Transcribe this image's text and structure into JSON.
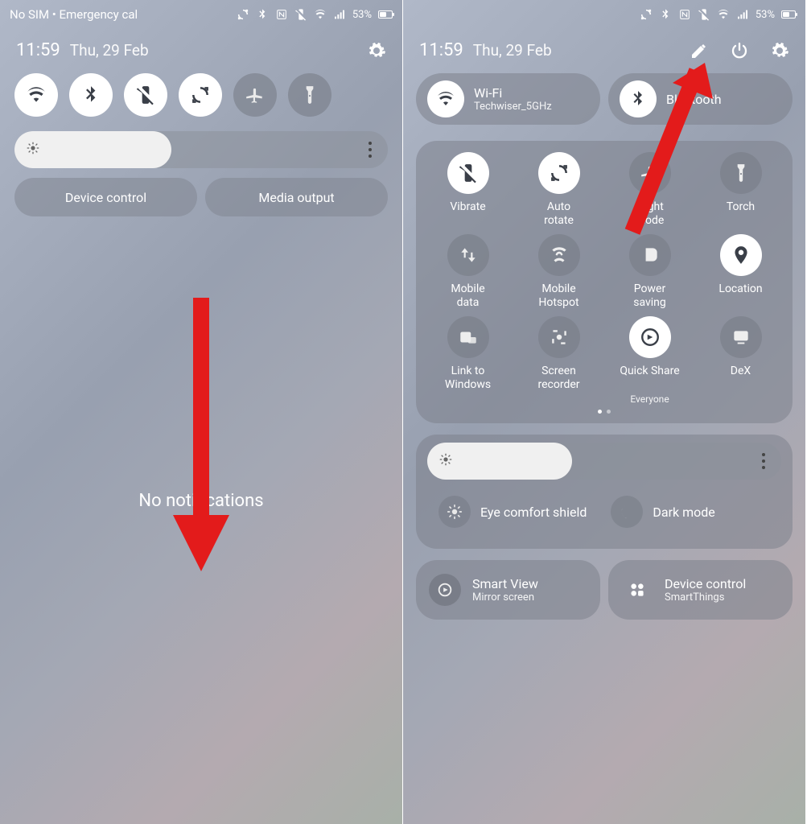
{
  "status": {
    "left_text": "No SIM • Emergency cal",
    "battery": "53%"
  },
  "panel": {
    "time": "11:59",
    "date": "Thu, 29 Feb"
  },
  "left": {
    "device_control": "Device control",
    "media_output": "Media output",
    "no_notifications": "No notifications"
  },
  "right": {
    "wifi": {
      "title": "Wi-Fi",
      "subtitle": "Techwiser_5GHz"
    },
    "bluetooth": {
      "title": "Bluetooth"
    },
    "tiles": [
      {
        "label": "Vibrate",
        "on": true,
        "icon": "vibrate"
      },
      {
        "label": "Auto\nrotate",
        "on": true,
        "icon": "autorotate"
      },
      {
        "label": "Flight\nmode",
        "on": false,
        "icon": "airplane"
      },
      {
        "label": "Torch",
        "on": false,
        "icon": "torch"
      },
      {
        "label": "Mobile\ndata",
        "on": false,
        "icon": "mobiledata"
      },
      {
        "label": "Mobile\nHotspot",
        "on": false,
        "icon": "hotspot"
      },
      {
        "label": "Power\nsaving",
        "on": false,
        "icon": "powersave"
      },
      {
        "label": "Location",
        "on": true,
        "icon": "location"
      },
      {
        "label": "Link to\nWindows",
        "on": false,
        "icon": "link"
      },
      {
        "label": "Screen\nrecorder",
        "on": false,
        "icon": "screenrec"
      },
      {
        "label": "Quick Share",
        "sub": "Everyone",
        "on": true,
        "icon": "quickshare"
      },
      {
        "label": "DeX",
        "on": false,
        "icon": "dex"
      }
    ],
    "eye_comfort": "Eye comfort shield",
    "dark_mode": "Dark mode",
    "smart_view": {
      "title": "Smart View",
      "subtitle": "Mirror screen"
    },
    "device_control": {
      "title": "Device control",
      "subtitle": "SmartThings"
    }
  }
}
